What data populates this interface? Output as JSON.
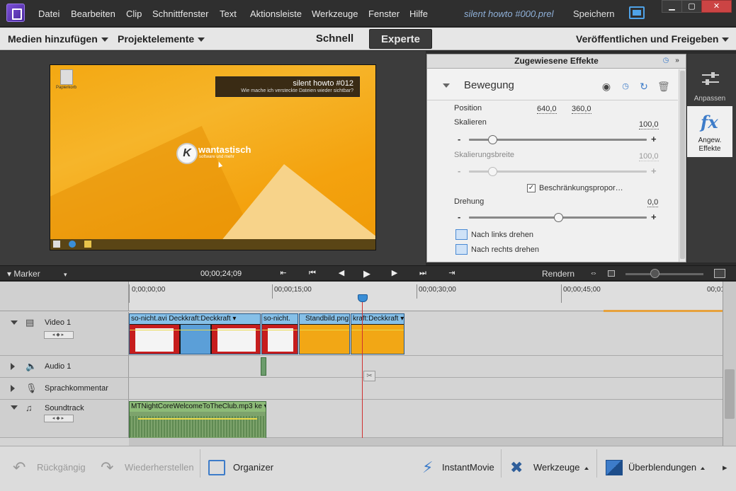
{
  "menubar": {
    "items": [
      "Datei",
      "Bearbeiten",
      "Clip",
      "Schnittfenster",
      "Text",
      "Aktionsleiste",
      "Werkzeuge",
      "Fenster",
      "Hilfe"
    ],
    "document_title": "silent howto #000.prel",
    "save_label": "Speichern"
  },
  "toolbar": {
    "add_media": "Medien hinzufügen",
    "project_assets": "Projektelemente",
    "mode_quick": "Schnell",
    "mode_expert": "Experte",
    "publish": "Veröffentlichen und Freigeben"
  },
  "monitor": {
    "title_line1": "silent howto #012",
    "title_line2": "Wie mache ich versteckte Dateien wieder sichtbar?",
    "brand": "wantastisch",
    "brand_sub": "software und mehr",
    "brand_letter": "K",
    "desktop_icon_label": "Papierkorb"
  },
  "effects": {
    "header": "Zugewiesene Effekte",
    "effect_name": "Bewegung",
    "position_label": "Position",
    "position_x": "640,0",
    "position_y": "360,0",
    "scale_label": "Skalieren",
    "scale_value": "100,0",
    "scale_fraction": 0.13,
    "scale_width_label": "Skalierungsbreite",
    "scale_width_value": "100,0",
    "constrain_label": "Beschränkungsproportionen",
    "constrain_display": "Beschränkungspropor…",
    "constrain_checked": true,
    "rotation_label": "Drehung",
    "rotation_value": "0,0",
    "rotation_fraction": 0.5,
    "rotate_left": "Nach links drehen",
    "rotate_right": "Nach rechts drehen"
  },
  "side_panel": {
    "adjust": "Anpassen",
    "applied_line1": "Angew.",
    "applied_line2": "Effekte"
  },
  "transport": {
    "marker": "Marker",
    "timecode": "00;00;24;09",
    "render": "Rendern"
  },
  "timeline": {
    "ruler": [
      "0;00;00;00",
      "00;00;15;00",
      "00;00;30;00",
      "00;00;45;00",
      "00;01"
    ],
    "tracks": {
      "video1": "Video 1",
      "audio1": "Audio 1",
      "narration": "Sprachkommentar",
      "soundtrack": "Soundtrack"
    },
    "clips": {
      "c1": "so-nicht.avi",
      "c1b": "Deckkraft:Deckkraft",
      "c2": "so-nicht.",
      "c3": "Standbild.png",
      "c4": "kraft:Deckkraft",
      "sound": "MTNightCoreWelcomeToTheClub.mp3",
      "sound_suffix": "ke"
    }
  },
  "bottombar": {
    "undo": "Rückgängig",
    "redo": "Wiederherstellen",
    "organizer": "Organizer",
    "instant_movie": "InstantMovie",
    "tools": "Werkzeuge",
    "transitions": "Überblendungen"
  },
  "colors": {
    "accent_blue": "#3d7cc9",
    "playhead": "#d03030",
    "video_clip_header": "#86c0e8",
    "audio_clip": "#7da36c"
  }
}
